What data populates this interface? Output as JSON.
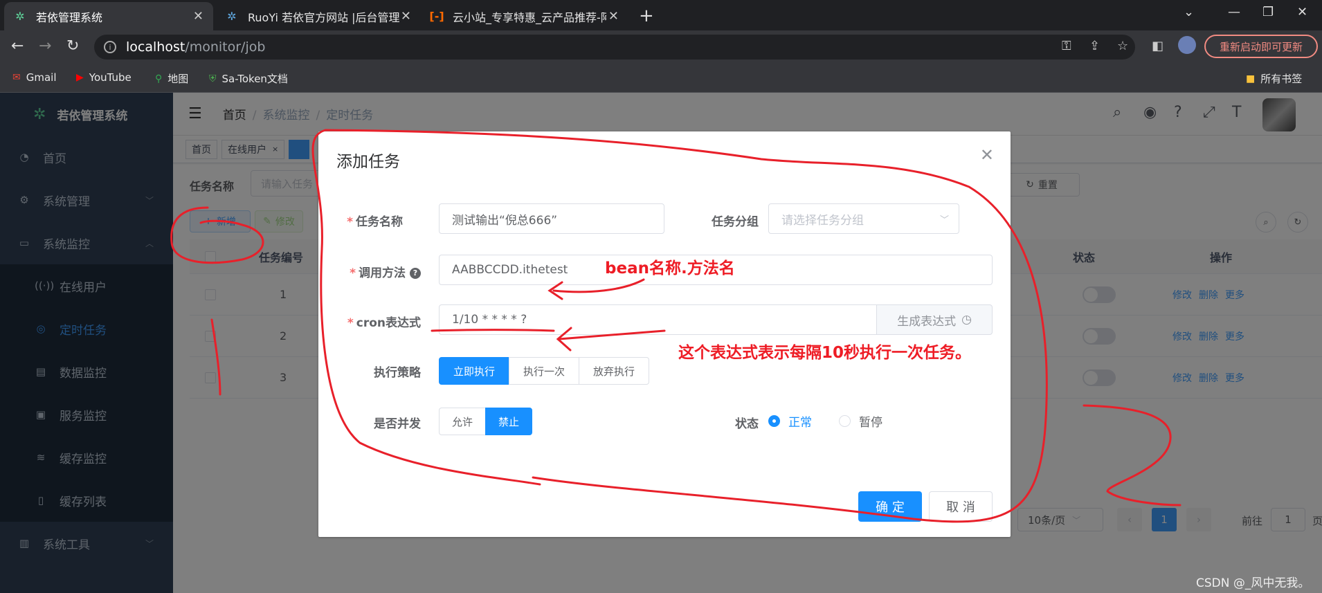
{
  "browser": {
    "tabs": [
      {
        "title": "若依管理系统",
        "active": true
      },
      {
        "title": "RuoYi 若依官方网站 |后台管理系",
        "active": false
      },
      {
        "title": "云小站_专享特惠_云产品推荐-阿",
        "active": false
      }
    ],
    "url_host": "localhost",
    "url_path": "/monitor/job",
    "update_button": "重新启动即可更新",
    "bookmarks": [
      "Gmail",
      "YouTube",
      "地图",
      "Sa-Token文档"
    ],
    "all_bookmarks": "所有书签"
  },
  "sidebar": {
    "logo": "若依管理系统",
    "items": [
      {
        "label": "首页",
        "icon": "dashboard-icon"
      },
      {
        "label": "系统管理",
        "icon": "gear-icon"
      },
      {
        "label": "系统监控",
        "icon": "monitor-icon"
      }
    ],
    "sub_items": [
      {
        "label": "在线用户",
        "icon": "online-icon"
      },
      {
        "label": "定时任务",
        "icon": "job-icon",
        "active": true
      },
      {
        "label": "数据监控",
        "icon": "chart-icon"
      },
      {
        "label": "服务监控",
        "icon": "server-icon"
      },
      {
        "label": "缓存监控",
        "icon": "stack-icon"
      },
      {
        "label": "缓存列表",
        "icon": "list-icon"
      }
    ],
    "tools": {
      "label": "系统工具",
      "icon": "toolbox-icon"
    }
  },
  "breadcrumb": [
    "首页",
    "系统监控",
    "定时任务"
  ],
  "tags": [
    "首页",
    "在线用户"
  ],
  "query": {
    "label": "任务名称",
    "placeholder": "请输入任务",
    "reset": "重置"
  },
  "toolbar": {
    "add": "新增",
    "edit": "修改"
  },
  "table": {
    "headers": {
      "id": "任务编号",
      "status": "状态",
      "ops": "操作"
    },
    "rows": [
      {
        "id": "1"
      },
      {
        "id": "2"
      },
      {
        "id": "3"
      }
    ],
    "ops": {
      "edit": "修改",
      "del": "删除",
      "more": "更多"
    }
  },
  "pagination": {
    "size": "10条/页",
    "page": "1",
    "goto": "前往",
    "goto_value": "1",
    "page_unit": "页"
  },
  "dialog": {
    "title": "添加任务",
    "job_name_label": "任务名称",
    "job_name_value": "测试输出“倪总666”",
    "job_group_label": "任务分组",
    "job_group_placeholder": "请选择任务分组",
    "invoke_label": "调用方法",
    "invoke_value": "AABBCCDD.ithetest",
    "cron_label": "cron表达式",
    "cron_value": "1/10 * * * * ?",
    "cron_button": "生成表达式",
    "policy_label": "执行策略",
    "policy_options": [
      "立即执行",
      "执行一次",
      "放弃执行"
    ],
    "concurrent_label": "是否并发",
    "concurrent_options": [
      "允许",
      "禁止"
    ],
    "status_label": "状态",
    "status_options": [
      "正常",
      "暂停"
    ],
    "ok": "确 定",
    "cancel": "取 消"
  },
  "annotations": {
    "bean": "bean名称.方法名",
    "cron": "这个表达式表示每隔10秒执行一次任务。"
  },
  "watermark": "CSDN @_风中无我。"
}
